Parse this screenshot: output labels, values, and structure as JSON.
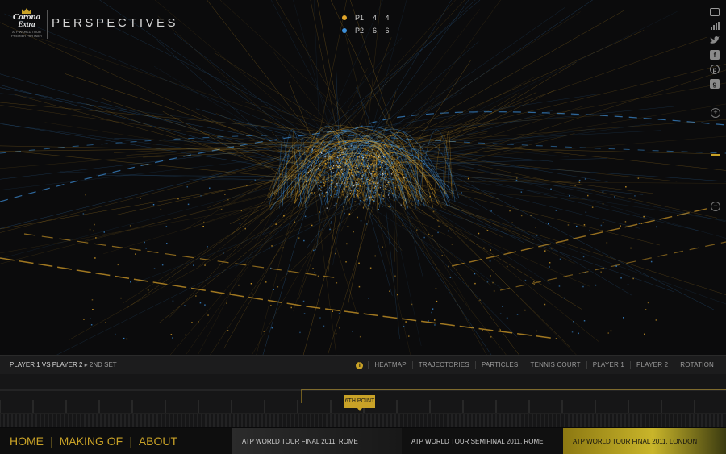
{
  "brand": {
    "logo_line1": "Corona",
    "logo_line2": "Extra",
    "logo_sub": "ATP WORLD TOUR PREMIER PARTNER",
    "title": "PERSPECTIVES"
  },
  "score": {
    "players": [
      {
        "name": "P1",
        "sets": "4 4",
        "color": "#e0a52a"
      },
      {
        "name": "P2",
        "sets": "6 6",
        "color": "#3d8fd9"
      }
    ]
  },
  "sidebar_icons": [
    "fullscreen-icon",
    "stats-icon",
    "twitter-icon",
    "facebook-icon",
    "pinterest-icon",
    "google-plus-icon"
  ],
  "zoom": {
    "plus": "+",
    "minus": "−",
    "level": 0.45
  },
  "toolbar": {
    "breadcrumb_match": "PLAYER 1 VS PLAYER 2",
    "breadcrumb_sep": "▸",
    "breadcrumb_set": "2ND SET",
    "info": "i",
    "tabs": [
      "HEATMAP",
      "TRAJECTORIES",
      "PARTICLES",
      "TENNIS COURT",
      "PLAYER 1",
      "PLAYER 2",
      "ROTATION"
    ]
  },
  "timeline": {
    "marker_label": "6TH POINT"
  },
  "footer": {
    "nav": [
      "HOME",
      "MAKING OF",
      "ABOUT"
    ],
    "nav_sep": "|",
    "panels": [
      "ATP WORLD TOUR FINAL 2011, ROME",
      "ATP WORLD TOUR SEMIFINAL 2011, ROME",
      "ATP WORLD TOUR FINAL 2011, LONDON"
    ]
  },
  "colors": {
    "accent": "#c9a227",
    "p1": "#e0a52a",
    "p2": "#3d8fd9"
  }
}
